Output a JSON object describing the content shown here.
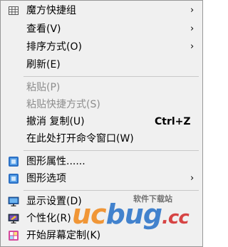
{
  "menu": {
    "items": [
      {
        "label": "魔方快捷组",
        "icon": "grid-icon",
        "submenu": true,
        "disabled": false
      },
      {
        "label": "查看(V)",
        "submenu": true,
        "disabled": false
      },
      {
        "label": "排序方式(O)",
        "submenu": true,
        "disabled": false
      },
      {
        "label": "刷新(E)",
        "submenu": false,
        "disabled": false
      },
      {
        "label": "粘贴(P)",
        "disabled": true
      },
      {
        "label": "粘贴快捷方式(S)",
        "disabled": true
      },
      {
        "label": "撤消 复制(U)",
        "shortcut": "Ctrl+Z",
        "disabled": false
      },
      {
        "label": "在此处打开命令窗口(W)",
        "disabled": false
      },
      {
        "label": "图形属性......",
        "icon": "intel-graphics-icon",
        "disabled": false
      },
      {
        "label": "图形选项",
        "icon": "intel-graphics-icon",
        "submenu": true,
        "disabled": false
      },
      {
        "label": "显示设置(D)",
        "icon": "display-settings-icon",
        "disabled": false
      },
      {
        "label": "个性化(R)",
        "icon": "personalize-icon",
        "disabled": false
      },
      {
        "label": "开始屏幕定制(K)",
        "icon": "start-screen-icon",
        "disabled": false
      }
    ],
    "submenu_arrow": "›"
  },
  "watermark": {
    "logo_part1": "uc",
    "logo_part2": "bug",
    "logo_part3": ".cc",
    "subtitle": "软件下载站",
    "colors": {
      "orange": "#f08a1e",
      "blue": "#2b73c9",
      "red": "#d32d2d"
    }
  },
  "colors": {
    "menu_background": "#f0f0f0",
    "disabled_text": "#8d8d8d",
    "separator": "#c8c8c8"
  }
}
